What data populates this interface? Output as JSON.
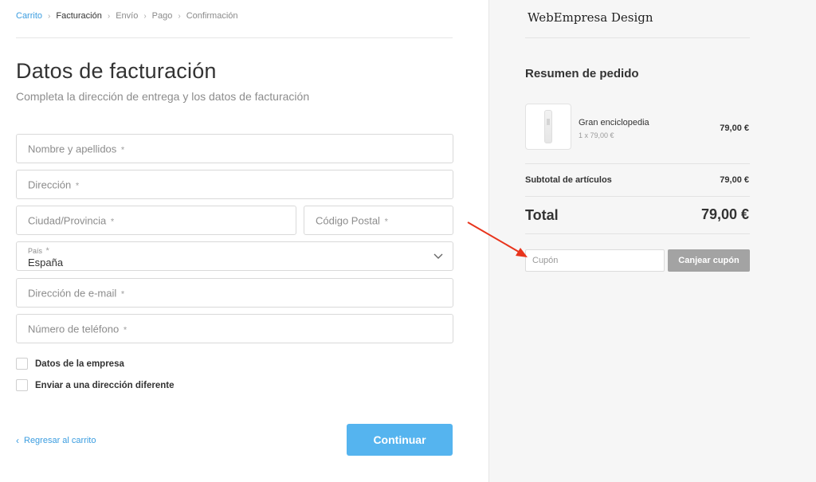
{
  "breadcrumb": {
    "items": [
      "Carrito",
      "Facturación",
      "Envío",
      "Pago",
      "Confirmación"
    ],
    "separator": "›"
  },
  "form": {
    "title": "Datos de facturación",
    "subtitle": "Completa la dirección de entrega y los datos de facturación",
    "required_mark": "*",
    "fields": {
      "name": "Nombre y apellidos",
      "address": "Dirección",
      "city": "Ciudad/Provincia",
      "postal": "Código Postal",
      "country_label": "País",
      "country_value": "España",
      "email": "Dirección de e-mail",
      "phone": "Número de teléfono"
    },
    "checkboxes": {
      "company": "Datos de la empresa",
      "different_address": "Enviar a una dirección diferente"
    },
    "back_link": "Regresar al carrito",
    "back_icon": "‹",
    "continue_label": "Continuar"
  },
  "summary": {
    "brand": "WebEmpresa Design",
    "title": "Resumen de pedido",
    "item": {
      "name": "Gran enciclopedia",
      "qty": "1 x 79,00 €",
      "price": "79,00 €"
    },
    "subtotal_label": "Subtotal de artículos",
    "subtotal_value": "79,00 €",
    "total_label": "Total",
    "total_value": "79,00 €",
    "coupon_placeholder": "Cupón",
    "coupon_button": "Canjear cupón"
  },
  "colors": {
    "accent": "#3b9de0",
    "button": "#55b4ef",
    "arrow": "#e8341c"
  }
}
